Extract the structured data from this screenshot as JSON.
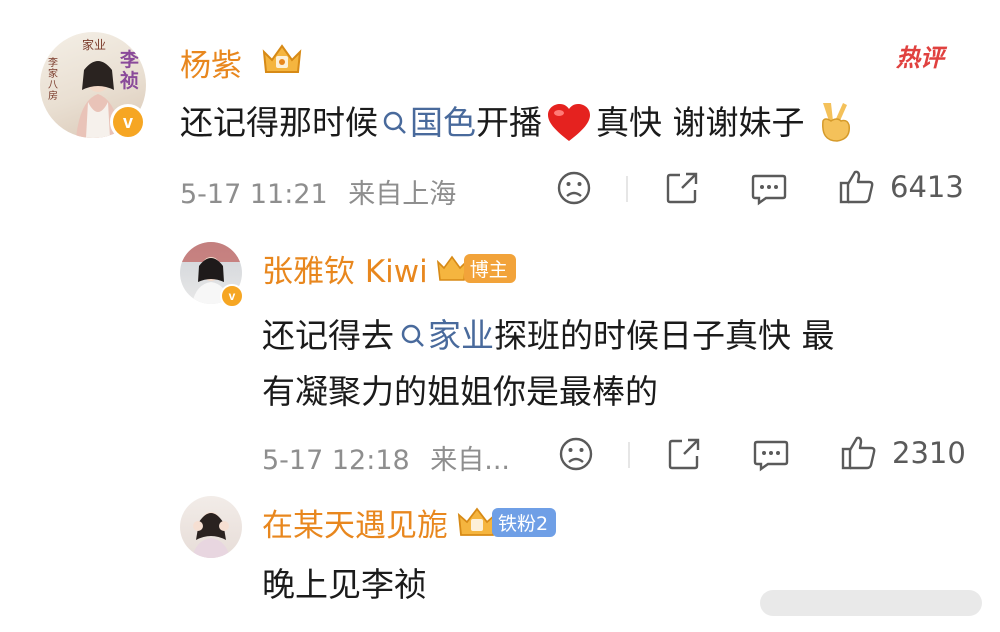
{
  "hot_label": "热评",
  "comments": [
    {
      "username": "杨紫",
      "avatar_text": {
        "top": "家业",
        "side": "李家八房",
        "big": "李祯"
      },
      "text": {
        "before": "还记得那时候",
        "topic": "国色",
        "middle": "开播",
        "after": "真快 谢谢妹子"
      },
      "time": "5-17 11:21",
      "location": "来自上海",
      "likes": "6413"
    },
    {
      "username": "张雅钦 Kiwi",
      "badge": "博主",
      "text": {
        "line1_before": "还记得去",
        "line1_topic": "家业",
        "line1_after": "探班的时候日子真快 最",
        "line2": "有凝聚力的姐姐你是最棒的"
      },
      "time": "5-17 12:18",
      "location": "来自...",
      "likes": "2310"
    },
    {
      "username": "在某天遇见旎",
      "badge": "铁粉2",
      "text": {
        "line1": "晚上见李祯"
      }
    }
  ],
  "colors": {
    "username": "#e8871e",
    "topic": "#496a9c",
    "hot": "#e0413f",
    "badge_blogger": "#f2a33a",
    "badge_fan": "#6f9fe6"
  }
}
